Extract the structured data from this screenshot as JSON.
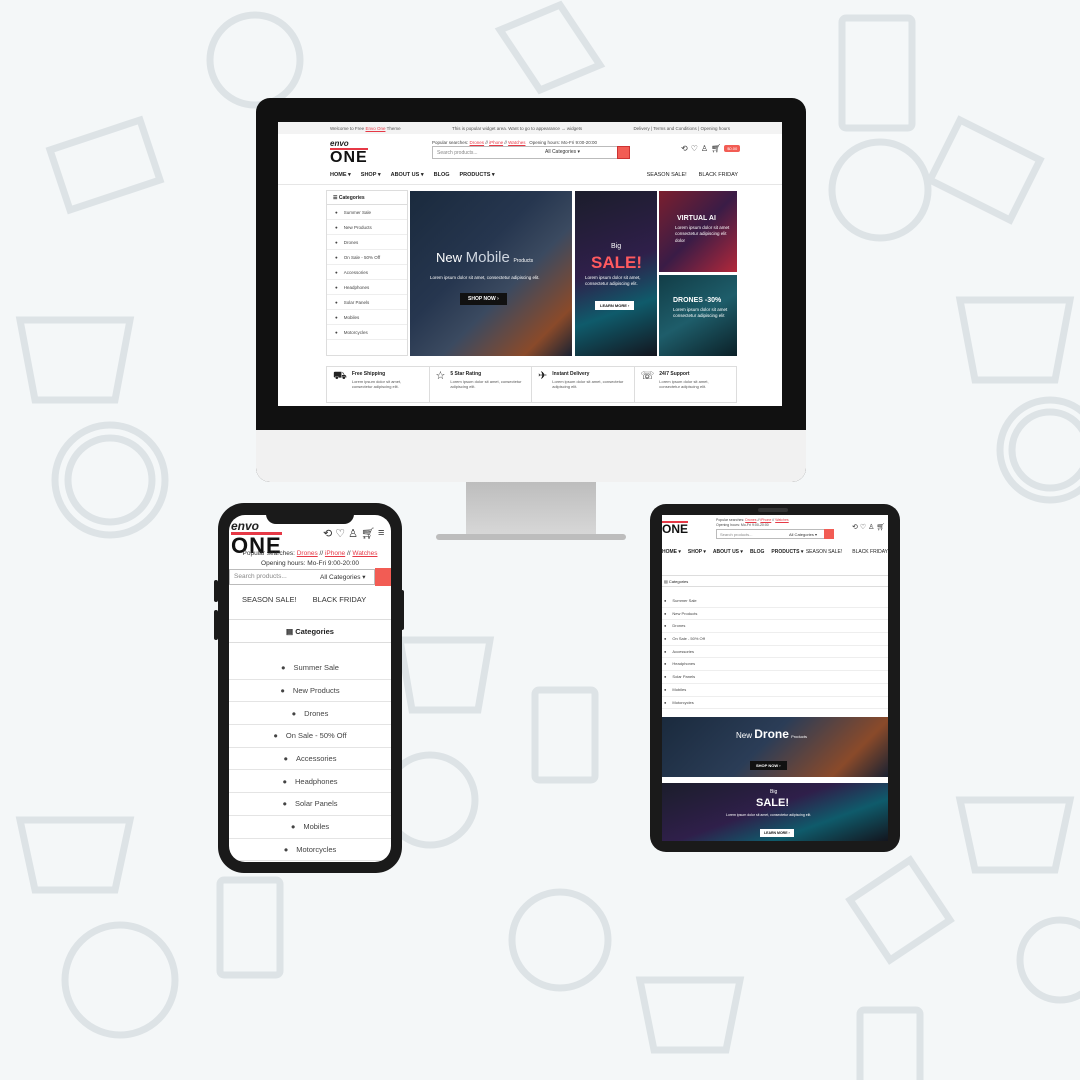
{
  "colors": {
    "accent": "#e63946",
    "button": "#f25c54",
    "background": "#f4f7f8"
  },
  "desktop": {
    "topbar": {
      "welcome_prefix": "Welcome to Free",
      "welcome_brand": "Envo One",
      "welcome_suffix": "Theme",
      "center": "This is popular widget area. Want to go to appearance → widgets",
      "right": "Delivery | Terms and Conditions | Opening hours"
    },
    "logo": {
      "top": "envo",
      "bottom": "ONE"
    },
    "popular": {
      "label": "Popular searches:",
      "links": [
        "Drones",
        "iPhone",
        "Watches"
      ],
      "hours": "Opening hours: Mo-Fri 9:00-20:00"
    },
    "search": {
      "placeholder": "Search products...",
      "category": "All Categories"
    },
    "cart": {
      "count": "0",
      "price": "$0.00"
    },
    "nav": {
      "items": [
        "HOME",
        "SHOP",
        "ABOUT US",
        "BLOG",
        "PRODUCTS"
      ],
      "right": [
        "SEASON SALE!",
        "BLACK FRIDAY"
      ]
    },
    "categories": {
      "title": "Categories",
      "items": [
        "Summer Sale",
        "New Products",
        "Drones",
        "On Sale - 50% Off",
        "Accessories",
        "Headphones",
        "Solar Panels",
        "Mobiles",
        "Motorcycles"
      ]
    },
    "hero_main": {
      "title_a": "New",
      "title_b": "Mobile",
      "title_c": "Products",
      "desc": "Lorem ipsum dolor sit amet, consectetur adipiscing elit.",
      "button": "SHOP NOW"
    },
    "hero_sale": {
      "small": "Big",
      "big": "SALE!",
      "desc": "Lorem ipsum dolor sit amet, consectetur adipiscing elit.",
      "button": "LEARN MORE"
    },
    "hero_ai": {
      "title": "VIRTUAL AI",
      "desc": "Lorem ipsum dolor sit amet consectetur adipiscing elit dolor"
    },
    "hero_drones": {
      "title": "DRONES -30%",
      "desc": "Lorem ipsum dolor sit amet consectetur adipiscing elit"
    },
    "features": [
      {
        "icon": "⛟",
        "title": "Free Shipping",
        "desc": "Lorem ipsum dolor sit amet, consectetur adipiscing elit."
      },
      {
        "icon": "☆",
        "title": "5 Star Rating",
        "desc": "Lorem ipsum dolor sit amet, consectetur adipiscing elit."
      },
      {
        "icon": "✈",
        "title": "Instant Delivery",
        "desc": "Lorem ipsum dolor sit amet, consectetur adipiscing elit."
      },
      {
        "icon": "☏",
        "title": "24/7 Support",
        "desc": "Lorem ipsum dolor sit amet, consectetur adipiscing elit."
      }
    ]
  },
  "mobile": {
    "logo": {
      "top": "envo",
      "bottom": "ONE"
    },
    "popular": {
      "label": "Popular searches:",
      "links": [
        "Drones",
        "iPhone",
        "Watches"
      ],
      "hours": "Opening hours: Mo-Fri 9:00-20:00"
    },
    "search": {
      "placeholder": "Search products...",
      "category": "All Categories"
    },
    "cart_count": "0",
    "tabs": [
      "SEASON SALE!",
      "BLACK FRIDAY"
    ],
    "categories_title": "Categories",
    "categories": [
      "Summer Sale",
      "New Products",
      "Drones",
      "On Sale - 50% Off",
      "Accessories",
      "Headphones",
      "Solar Panels",
      "Mobiles",
      "Motorcycles"
    ]
  },
  "tablet": {
    "logo": {
      "bottom": "ONE"
    },
    "popular": {
      "label": "Popular searches:",
      "links": [
        "Drones",
        "iPhone",
        "Watches"
      ],
      "hours": "Opening hours: Mo-Fri 9:00-20:00"
    },
    "search": {
      "placeholder": "Search products...",
      "category": "All Categories"
    },
    "cart_count": "0",
    "nav": [
      "HOME",
      "SHOP",
      "ABOUT US",
      "BLOG",
      "PRODUCTS"
    ],
    "nav_right": [
      "SEASON SALE!",
      "BLACK FRIDAY"
    ],
    "categories_title": "Categories",
    "categories": [
      "Summer Sale",
      "New Products",
      "Drones",
      "On Sale - 50% Off",
      "Accessories",
      "Headphones",
      "Solar Panels",
      "Mobiles",
      "Motorcycles"
    ],
    "hero_main": {
      "a": "New",
      "b": "Drone",
      "c": "Products",
      "button": "SHOP NOW"
    },
    "hero_sale": {
      "small": "Big",
      "big": "SALE!",
      "desc": "Lorem ipsum dolor sit amet, consectetur adipiscing elit.",
      "button": "LEARN MORE"
    }
  }
}
